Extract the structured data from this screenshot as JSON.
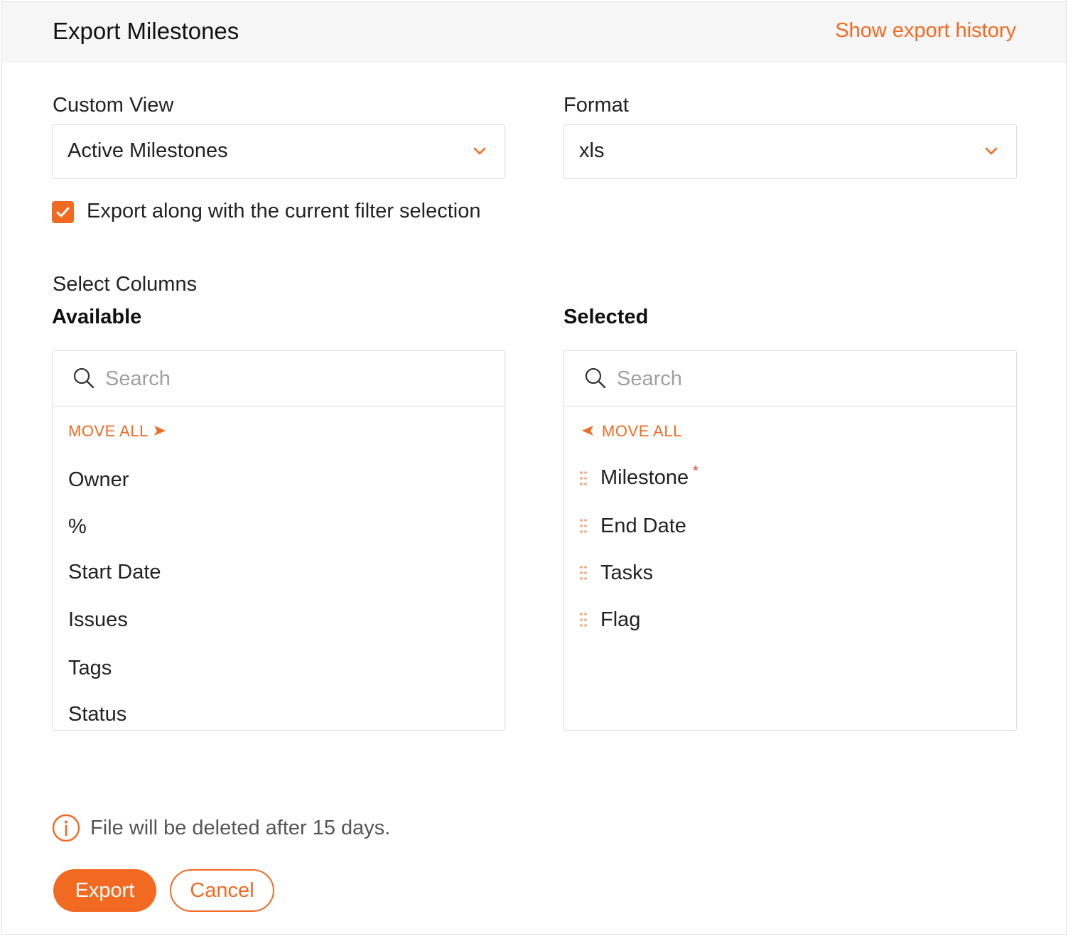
{
  "header": {
    "title": "Export Milestones",
    "history_link": "Show export history"
  },
  "custom_view": {
    "label": "Custom View",
    "value": "Active Milestones"
  },
  "format": {
    "label": "Format",
    "value": "xls"
  },
  "filter_checkbox": {
    "checked": true,
    "label": "Export along with the current filter selection"
  },
  "columns": {
    "section_title": "Select Columns",
    "available": {
      "heading": "Available",
      "search_placeholder": "Search",
      "move_all_label": "MOVE ALL",
      "items": [
        "Owner",
        "%",
        "Start Date",
        "Issues",
        "Tags",
        "Status"
      ]
    },
    "selected": {
      "heading": "Selected",
      "search_placeholder": "Search",
      "move_all_label": "MOVE ALL",
      "items": [
        {
          "label": "Milestone",
          "required_mark": "*"
        },
        {
          "label": "End Date"
        },
        {
          "label": "Tasks"
        },
        {
          "label": "Flag"
        }
      ]
    }
  },
  "info": {
    "text": "File will be deleted after 15 days."
  },
  "buttons": {
    "export": "Export",
    "cancel": "Cancel"
  },
  "colors": {
    "accent": "#f26a21",
    "required": "#e53935",
    "header_bg": "#f6f6f6",
    "border": "#dcdcdc"
  }
}
